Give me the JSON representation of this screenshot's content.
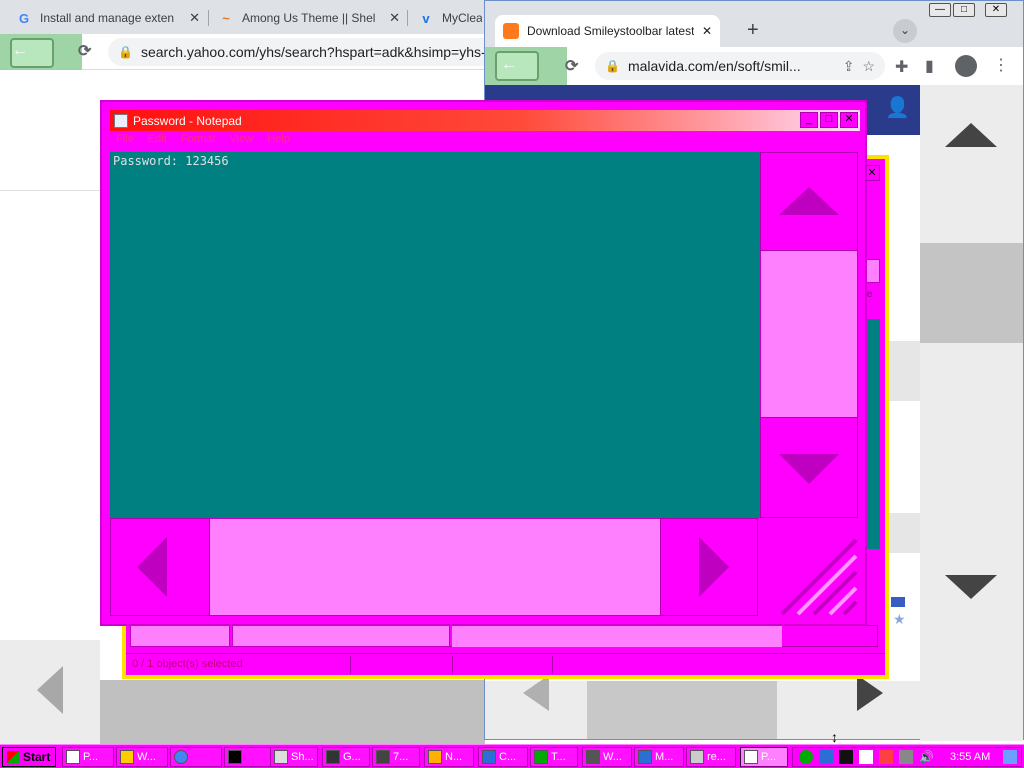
{
  "back_browser": {
    "tabs": [
      {
        "label": "Install and manage exten",
        "favicon": "G"
      },
      {
        "label": "Among Us Theme || Shel",
        "favicon": "~"
      },
      {
        "label": "MyClea",
        "favicon": "v"
      }
    ],
    "url": "search.yahoo.com/yhs/search?hspart=adk&hsimp=yhs-"
  },
  "front_browser": {
    "tab_title": "Download Smileystoolbar latest v",
    "url": "malavida.com/en/soft/smil...",
    "window_controls": [
      "minimize",
      "maximize",
      "close"
    ]
  },
  "file_manager": {
    "status_text": "0 / 1 object(s) selected"
  },
  "notepad": {
    "title": "Password - Notepad",
    "menu": [
      "File",
      "Edit",
      "Format",
      "View",
      "Help"
    ],
    "content": "Password: 123456"
  },
  "taskbar": {
    "start_label": "Start",
    "items": [
      "P...",
      "W...",
      "",
      "",
      "Sh...",
      "G...",
      "7...",
      "N...",
      "C...",
      "T...",
      "W...",
      "M...",
      "re...",
      "P..."
    ],
    "clock": "3:55 AM"
  },
  "colors": {
    "magenta": "#ff00ff",
    "pink": "#ff80ff",
    "teal_editor": "#008080",
    "title_gradient_start": "#ff1010"
  }
}
